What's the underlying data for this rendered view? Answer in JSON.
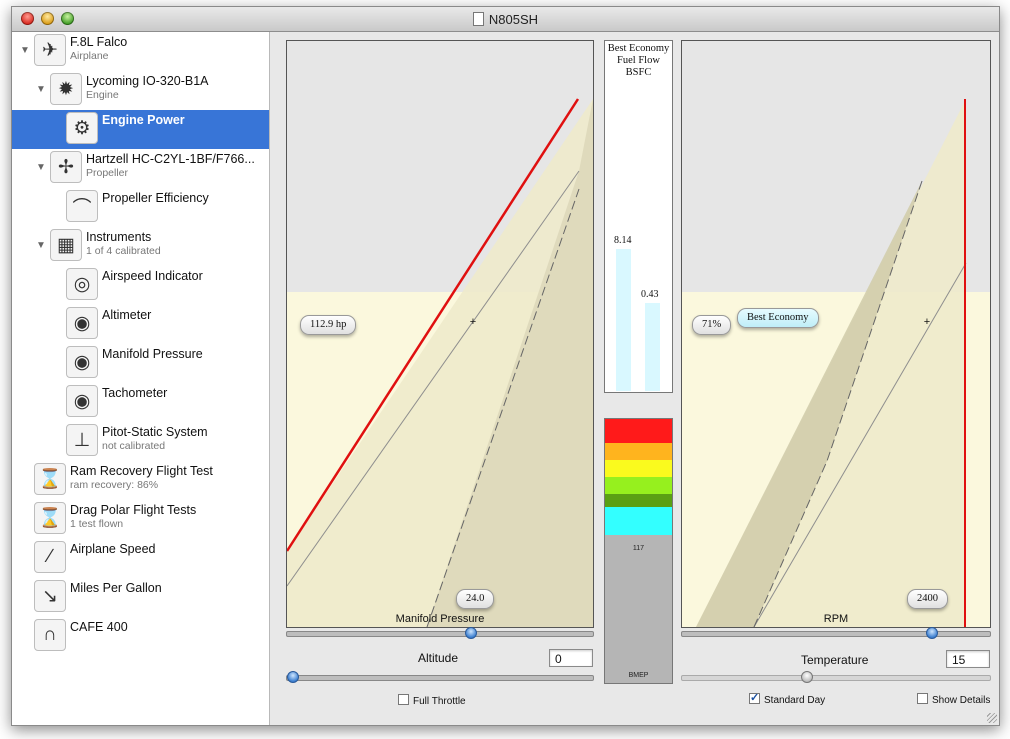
{
  "window": {
    "title": "N805SH"
  },
  "sidebar": {
    "items": [
      {
        "name": "F.8L Falco",
        "sub": "Airplane",
        "icon": "airplane-icon",
        "glyph": "✈",
        "disclosure": true
      },
      {
        "name": "Lycoming IO-320-B1A",
        "sub": "Engine",
        "icon": "engine-icon",
        "glyph": "✹",
        "disclosure": true
      },
      {
        "name": "Engine Power",
        "sub": "",
        "icon": "engine-power-icon",
        "glyph": "⚙",
        "selected": true
      },
      {
        "name": "Hartzell HC-C2YL-1BF/F766...",
        "sub": "Propeller",
        "icon": "propeller-icon",
        "glyph": "✢",
        "disclosure": true
      },
      {
        "name": "Propeller Efficiency",
        "sub": "",
        "icon": "curve-graph-icon",
        "glyph": "⌒"
      },
      {
        "name": "Instruments",
        "sub": "1 of 4 calibrated",
        "icon": "instrument-panel-icon",
        "glyph": "▦",
        "disclosure": true
      },
      {
        "name": "Airspeed Indicator",
        "sub": "",
        "icon": "airspeed-gauge-icon",
        "glyph": "◎"
      },
      {
        "name": "Altimeter",
        "sub": "",
        "icon": "altimeter-gauge-icon",
        "glyph": "◉"
      },
      {
        "name": "Manifold Pressure",
        "sub": "",
        "icon": "manifold-pressure-gauge-icon",
        "glyph": "◉"
      },
      {
        "name": "Tachometer",
        "sub": "",
        "icon": "tachometer-gauge-icon",
        "glyph": "◉"
      },
      {
        "name": "Pitot-Static System",
        "sub": "not calibrated",
        "icon": "pitot-tube-icon",
        "glyph": "⊥"
      },
      {
        "name": "Ram Recovery Flight Test",
        "sub": "ram recovery: 86%",
        "icon": "clipboard-test-icon",
        "glyph": "⌛"
      },
      {
        "name": "Drag Polar Flight Tests",
        "sub": "1 test flown",
        "icon": "clipboard-test-icon",
        "glyph": "⌛"
      },
      {
        "name": "Airplane Speed",
        "sub": "",
        "icon": "speed-curve-icon",
        "glyph": "∕"
      },
      {
        "name": "Miles Per Gallon",
        "sub": "",
        "icon": "mpg-curve-icon",
        "glyph": "↘"
      },
      {
        "name": "CAFE 400",
        "sub": "",
        "icon": "cafe-curve-icon",
        "glyph": "∩"
      }
    ]
  },
  "left_chart": {
    "value_pill": "112.9 hp",
    "x_pill": "24.0",
    "axis_label": "Manifold Pressure"
  },
  "right_chart": {
    "value_pill": "71%",
    "badge": "Best Economy",
    "x_pill": "2400",
    "axis_label": "RPM"
  },
  "fuel": {
    "title": "Best Economy Fuel Flow BSFC",
    "flow": "8.14",
    "bsfc": "0.43",
    "flow_fraction": 0.47,
    "bsfc_fraction": 0.29
  },
  "gauge": {
    "value": "117",
    "label": "BMEP",
    "colors": [
      "#ff1a1a",
      "#ffb41e",
      "#fafa1e",
      "#96f01e",
      "#5aa014",
      "#33ffff"
    ]
  },
  "controls": {
    "manifold_pressure_slider": 0.6,
    "rpm_slider": 0.82,
    "altitude": {
      "label": "Altitude",
      "value": "0",
      "slider": 0.0
    },
    "temperature": {
      "label": "Temperature",
      "value": "15",
      "slider": 0.4
    },
    "full_throttle": {
      "label": "Full Throttle",
      "checked": false
    },
    "standard_day": {
      "label": "Standard Day",
      "checked": true
    },
    "show_details": {
      "label": "Show Details",
      "checked": false
    }
  },
  "colors": {
    "selection": "#3875d7",
    "power_line": "#e01010",
    "envelope": "#fbf8dd"
  }
}
